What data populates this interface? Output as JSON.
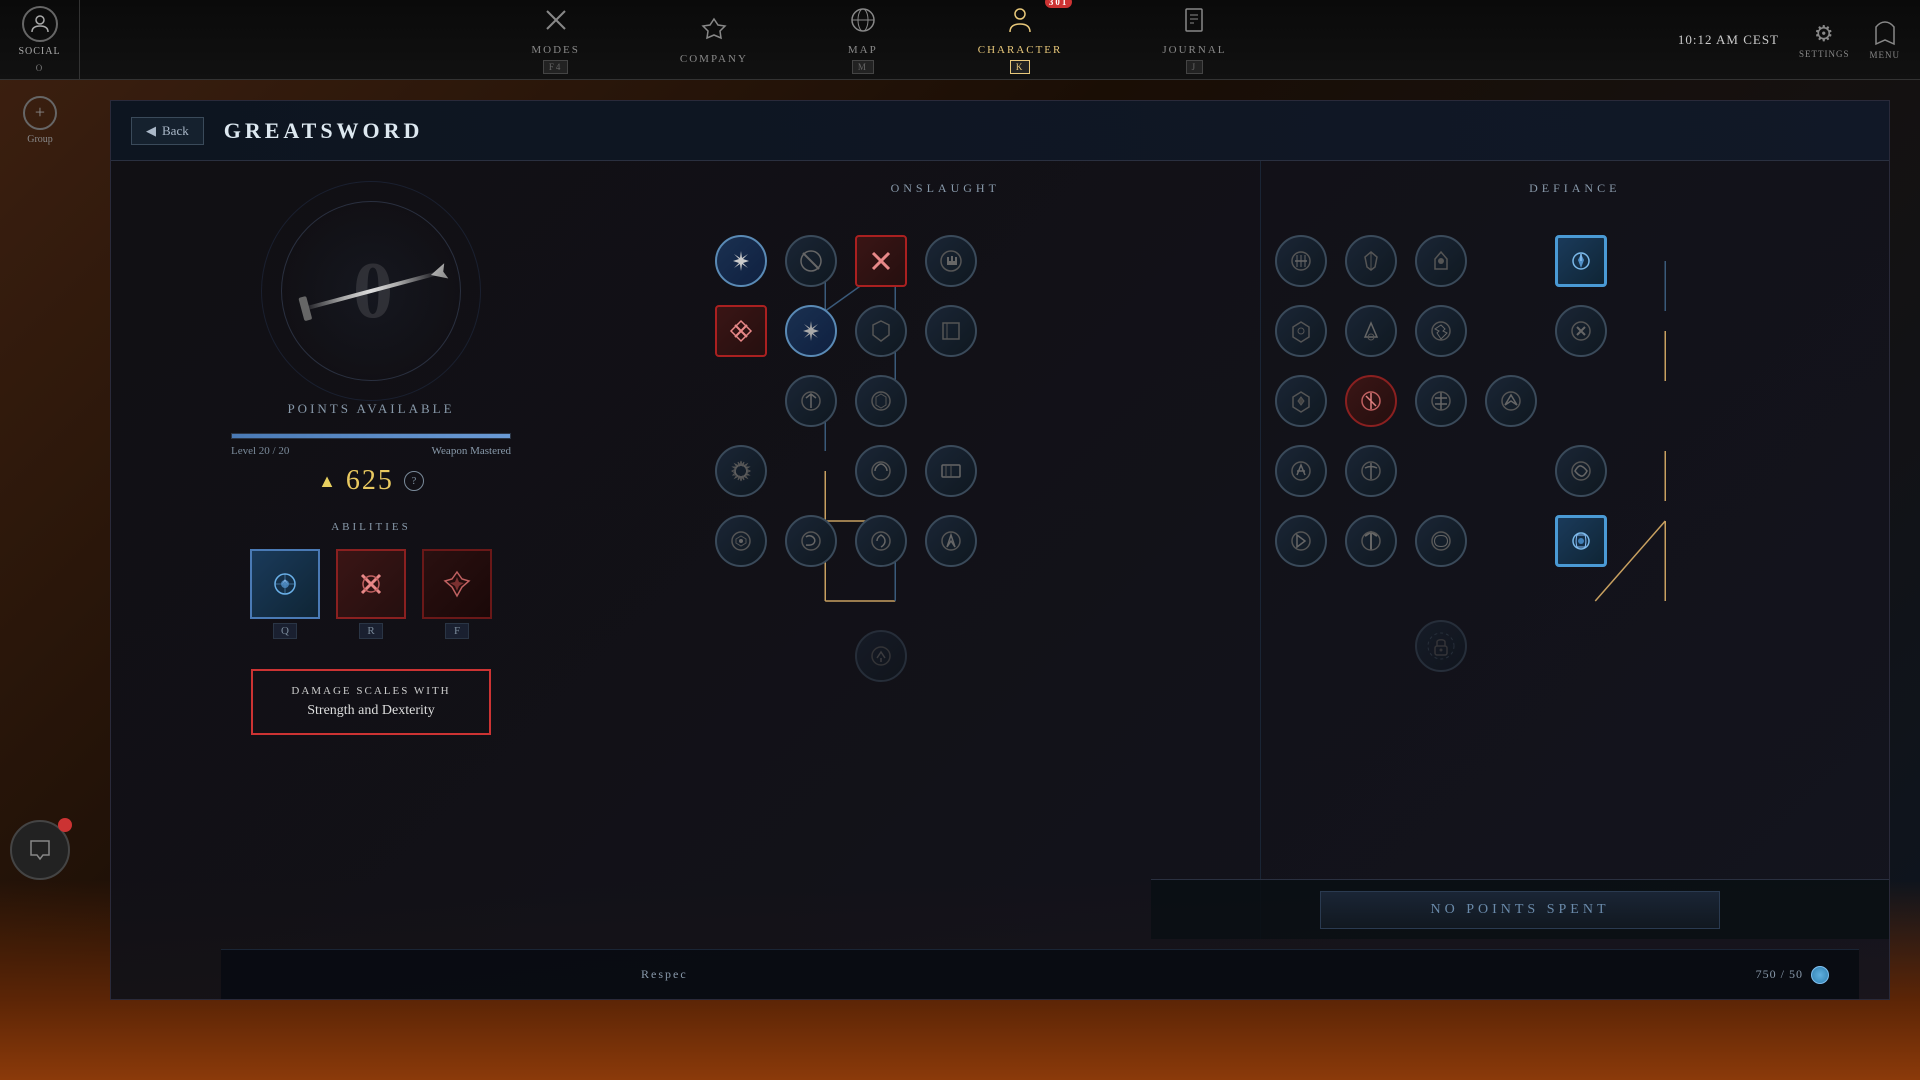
{
  "topbar": {
    "social_label": "SOCIAL",
    "social_key": "O",
    "nav_items": [
      {
        "id": "modes",
        "label": "MODES",
        "icon": "✕",
        "key": "F4"
      },
      {
        "id": "company",
        "label": "COMPANY",
        "icon": "🔰",
        "key": ""
      },
      {
        "id": "map",
        "label": "MAP",
        "icon": "🌐",
        "key": "M"
      },
      {
        "id": "character",
        "label": "CHARACTER",
        "icon": "👤",
        "key": "K",
        "badge": "301",
        "active": true
      },
      {
        "id": "journal",
        "label": "JOURNAL",
        "icon": "📖",
        "key": "J"
      }
    ],
    "time": "10:12 AM CEST",
    "settings_label": "SETTINGS",
    "menu_label": "MENU"
  },
  "panel": {
    "back_label": "Back",
    "title": "GREATSWORD",
    "points_available": "0",
    "points_label": "POINTS AVAILABLE",
    "level": "20",
    "level_max": "20",
    "weapon_mastered": "Weapon Mastered",
    "mastery_score": "625",
    "abilities_label": "ABILITIES",
    "abilities": [
      {
        "key": "Q",
        "type": "active-blue"
      },
      {
        "key": "R",
        "type": "active-red"
      },
      {
        "key": "F",
        "type": "active-darkred"
      }
    ],
    "damage_scales_title": "DAMAGE SCALES WITH",
    "damage_scales_value": "Strength and Dexterity"
  },
  "onslaught": {
    "title": "ONSLAUGHT"
  },
  "defiance": {
    "title": "DEFIANCE"
  },
  "bottom": {
    "no_points_label": "NO POINTS SPENT"
  },
  "respec": {
    "label": "Respec",
    "cost": "750 / 50"
  },
  "group": {
    "label": "Group"
  }
}
